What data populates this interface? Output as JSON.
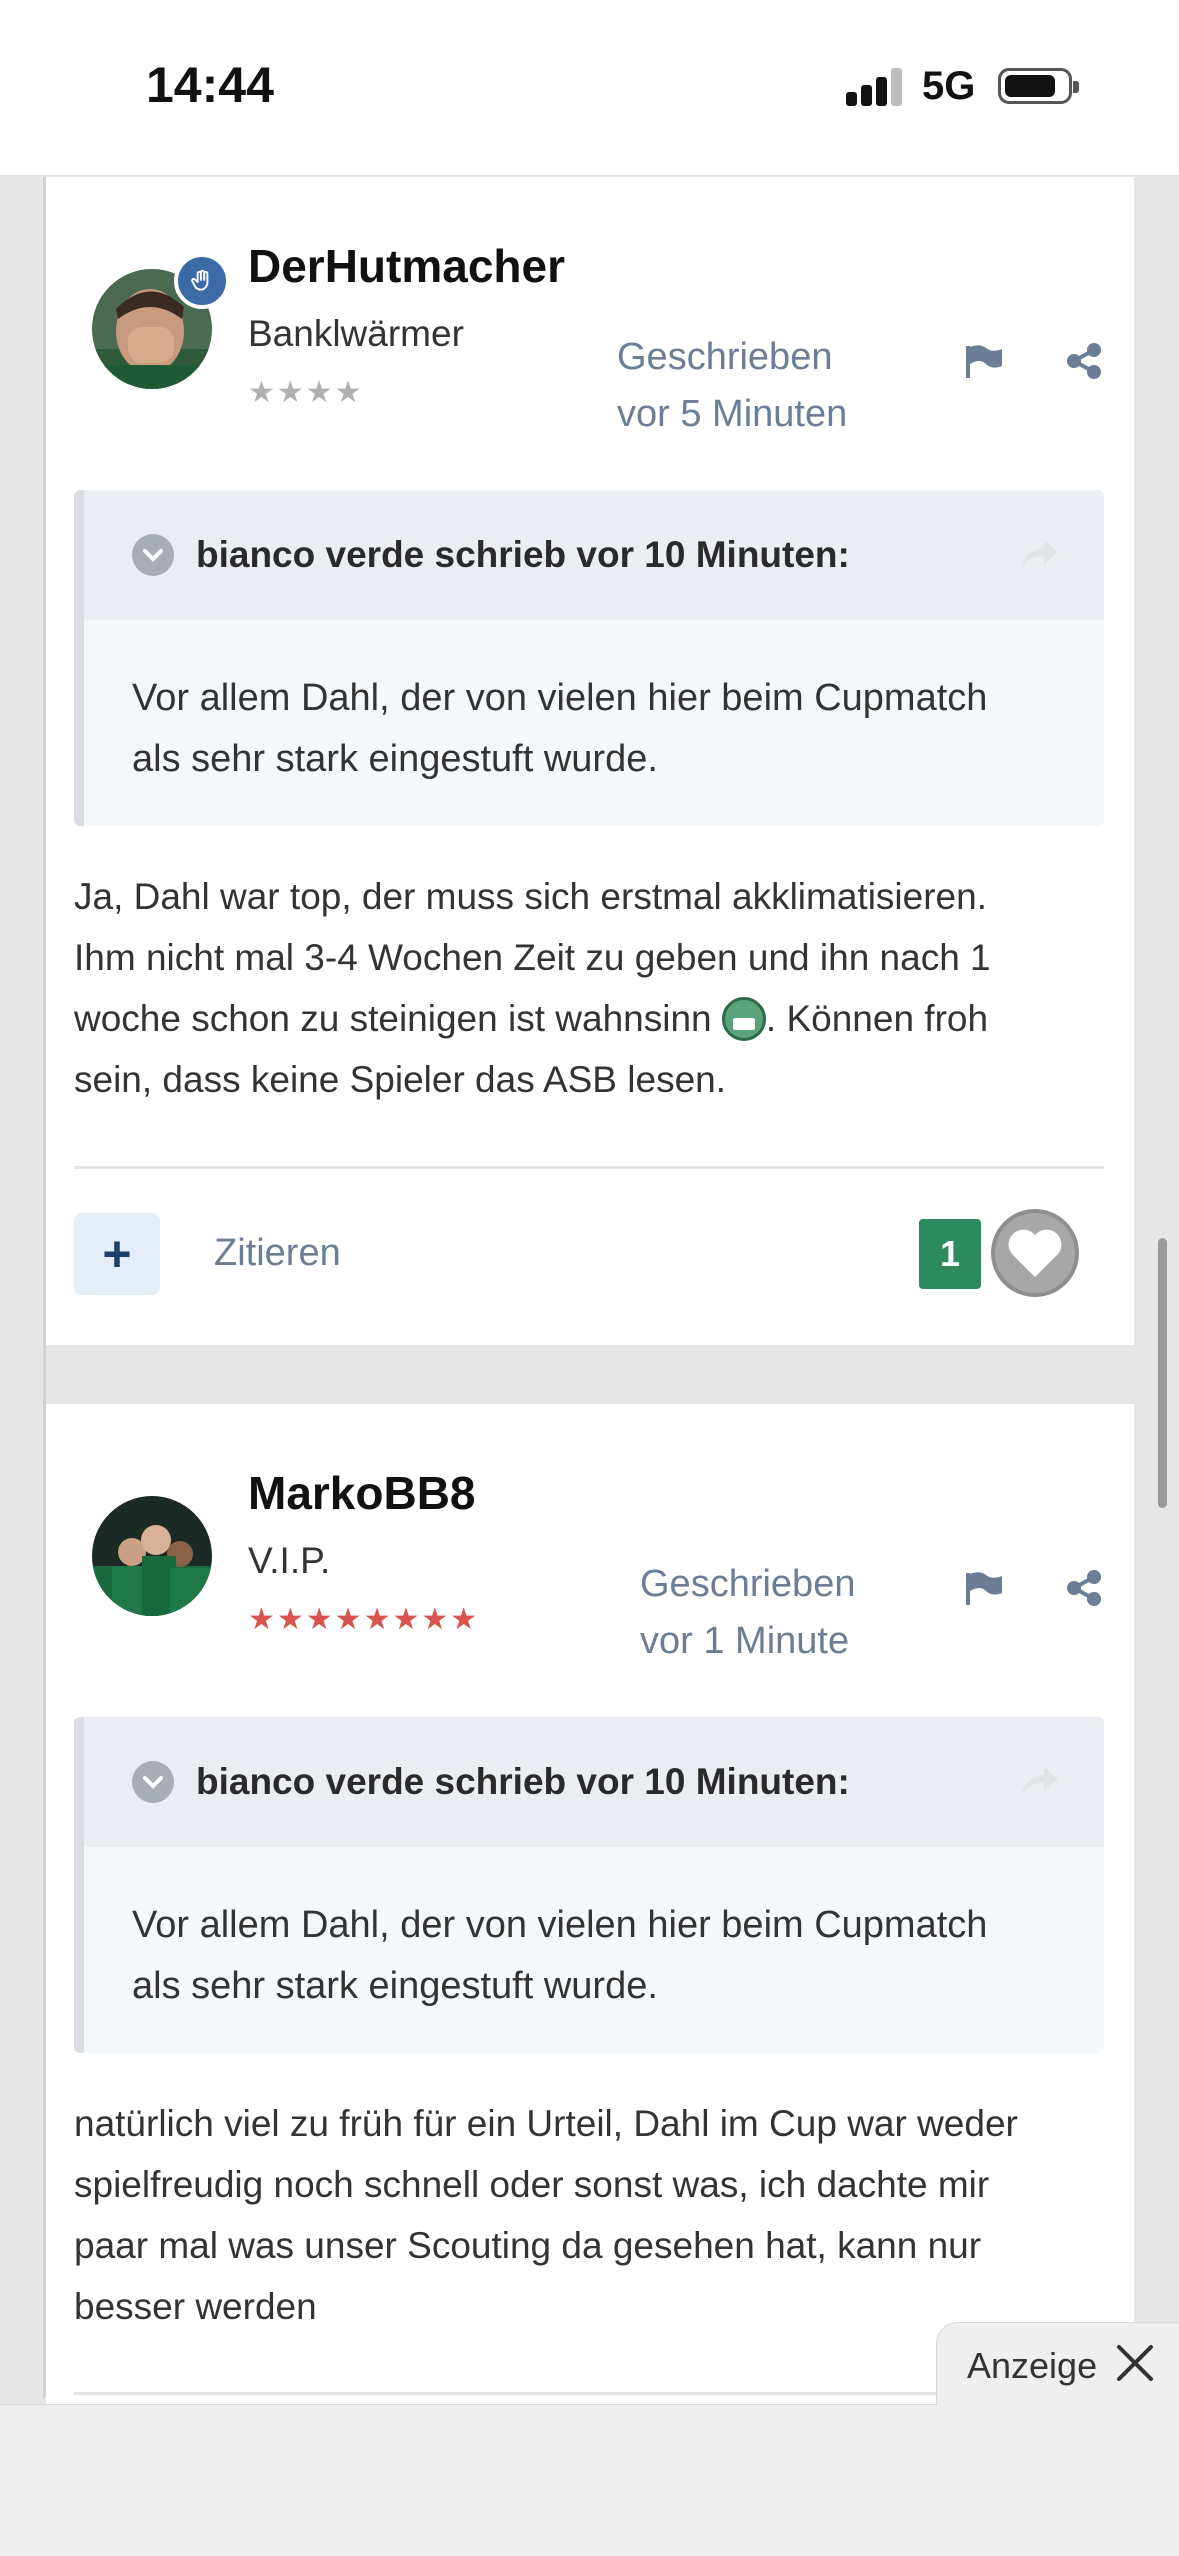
{
  "status_bar": {
    "time": "14:44",
    "network": "5G"
  },
  "posts": [
    {
      "author": "DerHutmacher",
      "rank": "Banklwärmer",
      "stars": "★★★★",
      "posted_line1": "Geschrieben",
      "posted_line2": "vor 5 Minuten",
      "quote": {
        "author_line": "bianco verde schrieb vor 10 Minuten:",
        "text_line1": "Vor allem Dahl, der von vielen hier beim Cupmatch",
        "text_line2": "als sehr stark eingestuft wurde."
      },
      "text_line1": "Ja, Dahl war top, der muss sich erstmal akklimatisieren.",
      "text_line2": "Ihm nicht mal 3-4 Wochen Zeit zu geben und ihn nach 1",
      "text_line3a": "woche schon zu steinigen ist wahnsinn",
      "text_line3b": ". Können froh",
      "text_line4": "sein, dass keine Spieler das ASB lesen.",
      "add_label": "+",
      "quote_action": "Zitieren",
      "like_count": "1"
    },
    {
      "author": "MarkoBB8",
      "rank": "V.I.P.",
      "stars": "★★★★★★★★",
      "posted_line1": "Geschrieben",
      "posted_line2": "vor 1 Minute",
      "quote": {
        "author_line": "bianco verde schrieb vor 10 Minuten:",
        "text_line1": "Vor allem Dahl, der von vielen hier beim Cupmatch",
        "text_line2": "als sehr stark eingestuft wurde."
      },
      "text_line1": "natürlich viel zu früh für ein Urteil, Dahl im Cup war weder",
      "text_line2": "spielfreudig noch schnell oder sonst was, ich dachte mir",
      "text_line3": "paar mal was unser Scouting da gesehen hat, kann nur",
      "text_line4": "besser werden"
    }
  ],
  "ad": {
    "label": "Anzeige"
  },
  "colors": {
    "accent": "#6b7e96",
    "like_green": "#2d8a5c",
    "badge_blue": "#3c6aa6",
    "stars_red": "#d9534f",
    "stars_grey": "#b0b0b0"
  },
  "icons": [
    "hand-badge-icon",
    "flag-icon",
    "share-icon",
    "chevron-down-icon",
    "reply-arrow-icon",
    "heart-icon",
    "close-icon",
    "signal-icon",
    "battery-icon"
  ]
}
